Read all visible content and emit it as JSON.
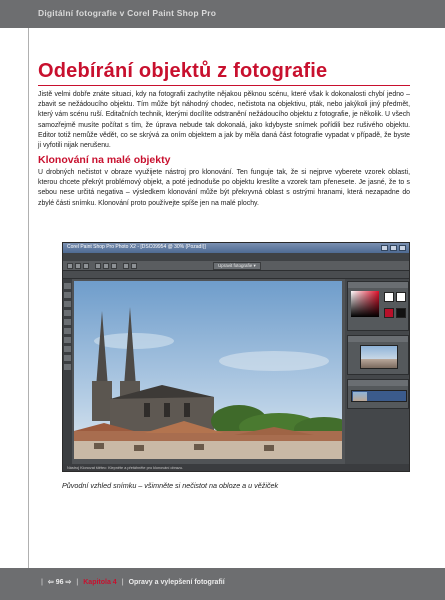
{
  "header": {
    "running_title": "Digitální fotografie v Corel Paint Shop Pro"
  },
  "chapter_heading": "Odebírání objektů z fotografie",
  "intro_text": "Jistě velmi dobře znáte situaci, kdy na fotografii zachytíte nějakou pěknou scénu, které však k dokonalosti chybí jedno – zbavit se nežádoucího objektu. Tím může být náhodný chodec, nečistota na objektivu, pták, nebo jakýkoli jiný předmět, který vám scénu ruší. Editačních technik, kterými docílíte odstranění nežádoucího objektu z fotografie, je několik. U všech samozřejmě musíte počítat s tím, že úprava nebude tak dokonalá, jako kdybyste snímek pořídili bez rušivého objektu. Editor totiž nemůže vědět, co se skrývá za oním objektem a jak by měla daná část fotografie vypadat v případě, že byste ji vyfotili nijak nerušenu.",
  "section_heading": "Klonování na malé objekty",
  "section_text": "U drobných nečistot v obraze využijete nástroj pro klonování. Ten funguje tak, že si nejprve vyberete vzorek oblasti, kterou chcete překrýt problémový objekt, a poté jednoduše po objektu kreslíte a vzorek tam přenesete. Je jasné, že to s sebou nese určitá negativa – výsledkem klonování může být překryvná oblast s ostrými hranami, která nezapadne do zbylé části snímku. Klonování proto používejte spíše jen na malé plochy.",
  "screenshot": {
    "window_title": "Corel Paint Shop Pro Photo X2 - [DSC09954 @ 30% (Pozadí)]",
    "workspace_button": "Upravit fotografie ▾",
    "status_text": "Nástroj Klonovat štětec: Klepněte a přetáhněte pro klonování obrazu."
  },
  "caption": "Původní vzhled snímku – všimněte si nečistot na obloze a u věžiček",
  "footer": {
    "page_number": "96",
    "chapter_label": "Kapitola 4",
    "chapter_title": "Opravy a vylepšení fotografií"
  },
  "colors": {
    "accent": "#c8102e",
    "band": "#6d6e70"
  }
}
